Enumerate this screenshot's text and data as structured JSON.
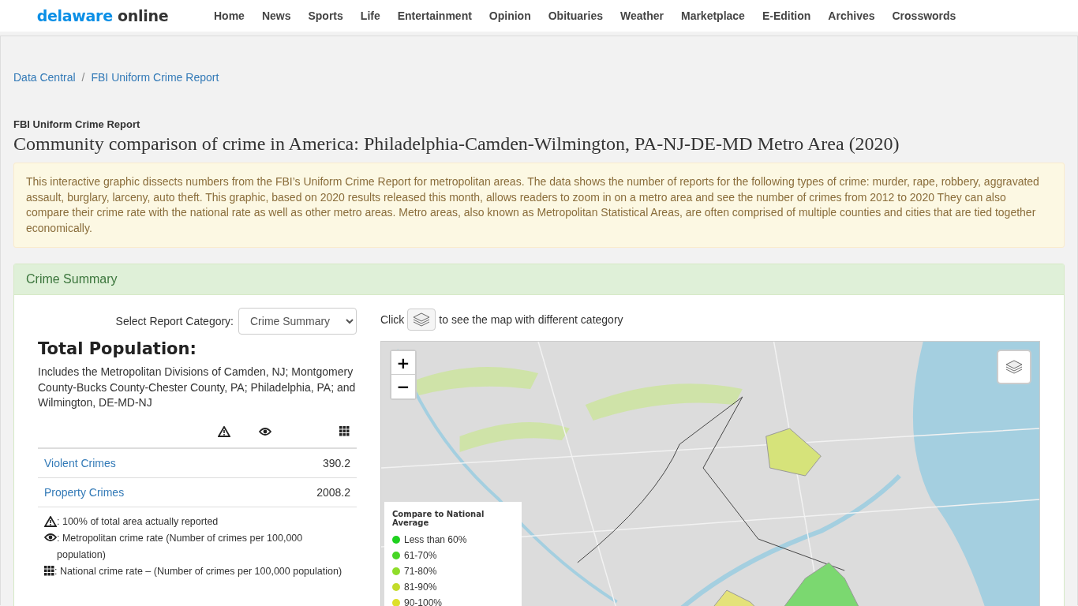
{
  "header": {
    "logo": {
      "part_1": "delaware",
      "part_2": "online"
    },
    "nav": [
      "Home",
      "News",
      "Sports",
      "Life",
      "Entertainment",
      "Opinion",
      "Obituaries",
      "Weather",
      "Marketplace",
      "E-Edition",
      "Archives",
      "Crosswords"
    ]
  },
  "breadcrumb": [
    "Data Central",
    "FBI Uniform Crime Report"
  ],
  "breadcrumb_separator": "/",
  "kicker": "FBI Uniform Crime Report",
  "title": "Community comparison of crime in America: Philadelphia-Camden-Wilmington, PA-NJ-DE-MD Metro Area (2020)",
  "intro": "This interactive graphic dissects numbers from the FBI’s Uniform Crime Report for metropolitan areas. The data shows the number of reports for the following types of crime: murder, rape, robbery, aggravated assault, burglary, larceny, auto theft. This graphic, based on 2020 results released this month, allows readers to zoom in on a metro area and see the number of crimes from 2012 to 2020 They can also compare their crime rate with the national rate as well as other metro areas. Metro areas, also known as Metropolitan Statistical Areas, are often comprised of multiple counties and cities that are tied together economically.",
  "panel": {
    "heading": "Crime Summary",
    "category_label": "Select Report Category:",
    "category_value": "Crime Summary",
    "population_heading": "Total Population:",
    "population_note": "Includes the Metropolitan Divisions of Camden, NJ; Montgomery County-Bucks County-Chester County, PA; Philadelphia, PA; and Wilmington, DE-MD-NJ",
    "rows": [
      {
        "label": "Violent Crimes",
        "value": "390.2"
      },
      {
        "label": "Property Crimes",
        "value": "2008.2"
      }
    ],
    "footnotes": [
      {
        "kind": "warning",
        "text": ": 100% of total area actually reported"
      },
      {
        "kind": "eye",
        "text": ": Metropolitan crime rate (Number of crimes per 100,000 population)"
      },
      {
        "kind": "grid",
        "text": ": National crime rate – (Number of crimes per 100,000 population)"
      }
    ]
  },
  "map_hint": {
    "before": "Click",
    "after": "to see the map with different category"
  },
  "map": {
    "zoom_in": "+",
    "zoom_out": "−",
    "legend": {
      "title": "Compare to National Average",
      "items": [
        {
          "label": "Less than 60%",
          "color": "#1fd11f"
        },
        {
          "label": "61-70%",
          "color": "#47d625"
        },
        {
          "label": "71-80%",
          "color": "#8fdd2a"
        },
        {
          "label": "81-90%",
          "color": "#c3dc2a"
        },
        {
          "label": "90-100%",
          "color": "#dde02a"
        }
      ]
    }
  }
}
